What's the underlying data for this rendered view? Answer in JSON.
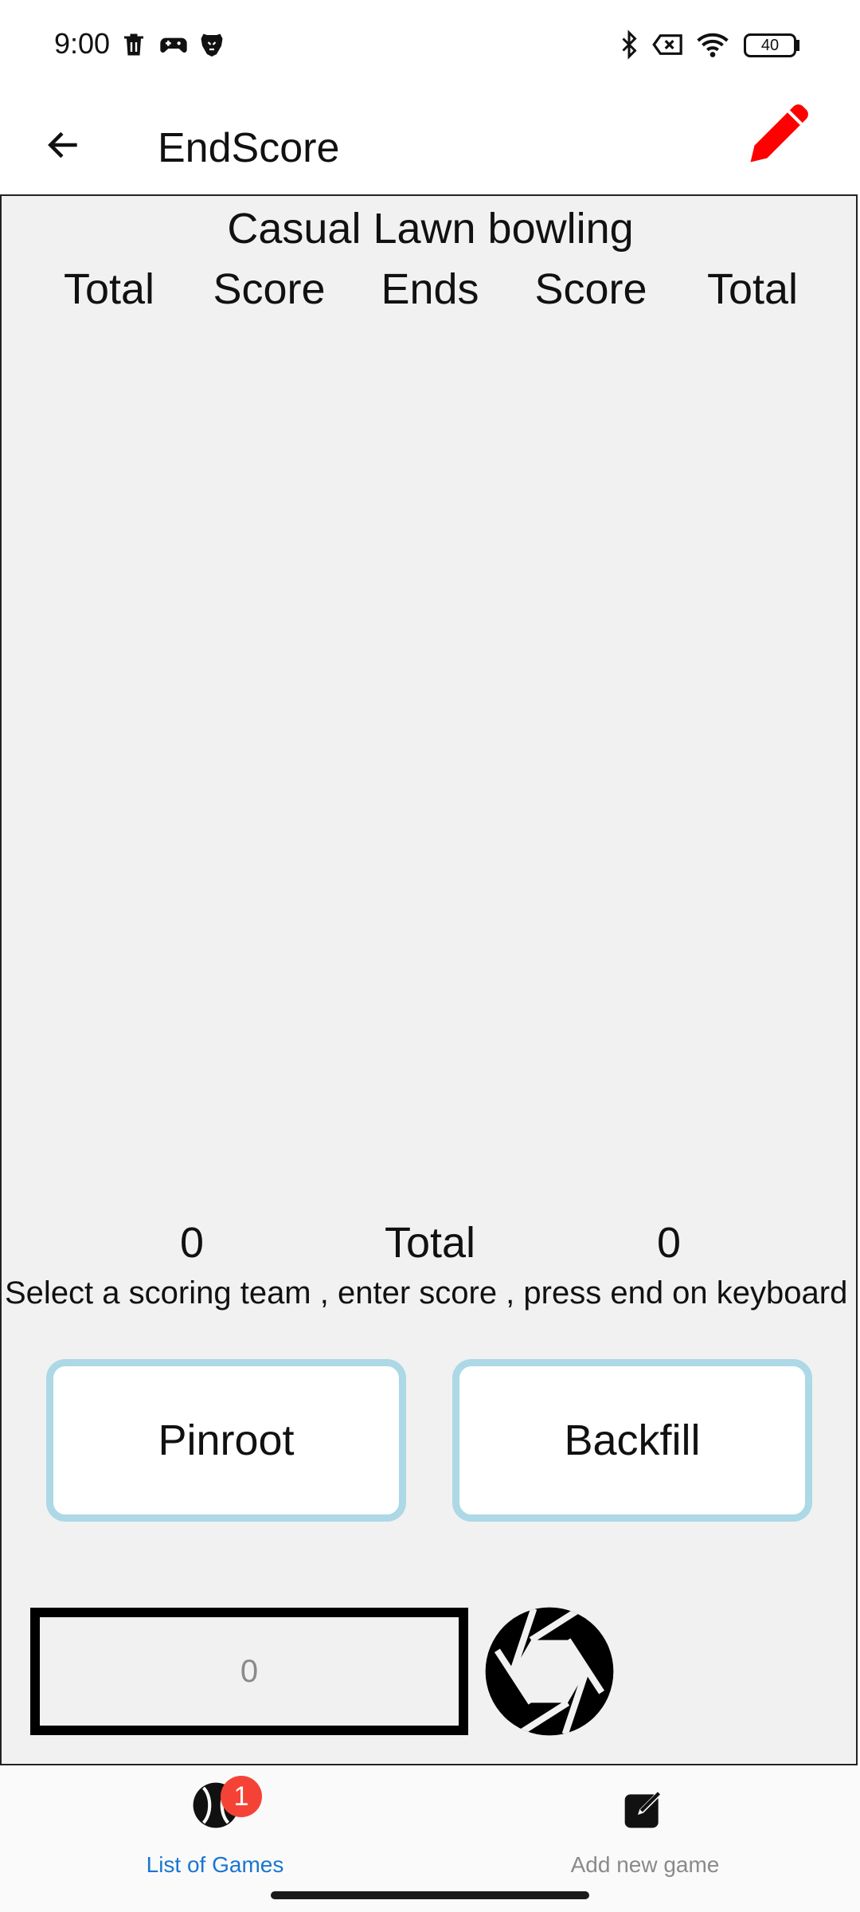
{
  "status_bar": {
    "time": "9:00",
    "battery": "40",
    "icons_left": [
      "trash-icon",
      "gamepad-icon",
      "brave-lion-icon"
    ],
    "icons_right": [
      "bluetooth-icon",
      "no-sim-icon",
      "wifi-icon",
      "battery-icon"
    ]
  },
  "app_bar": {
    "title": "EndScore",
    "back_icon": "arrow-left-icon",
    "edit_icon": "pencil-icon",
    "edit_color": "#ff0000"
  },
  "game": {
    "title": "Casual Lawn bowling",
    "columns": [
      "Total",
      "Score",
      "Ends",
      "Score",
      "Total"
    ],
    "total_left": "0",
    "total_label": "Total",
    "total_right": "0",
    "instructions": "Select a scoring team , enter score , press end on keyboard"
  },
  "buttons": {
    "pinroot": "Pinroot",
    "backfill": "Backfill",
    "border_color": "#add8e6"
  },
  "score_input": {
    "placeholder": "0"
  },
  "bottom_nav": {
    "items": [
      {
        "label": "List of Games",
        "icon": "ball-icon",
        "badge": "1",
        "active": true,
        "color": "#1976d2"
      },
      {
        "label": "Add new game",
        "icon": "edit-square-icon",
        "active": false,
        "color": "#8a8a8a"
      }
    ]
  }
}
